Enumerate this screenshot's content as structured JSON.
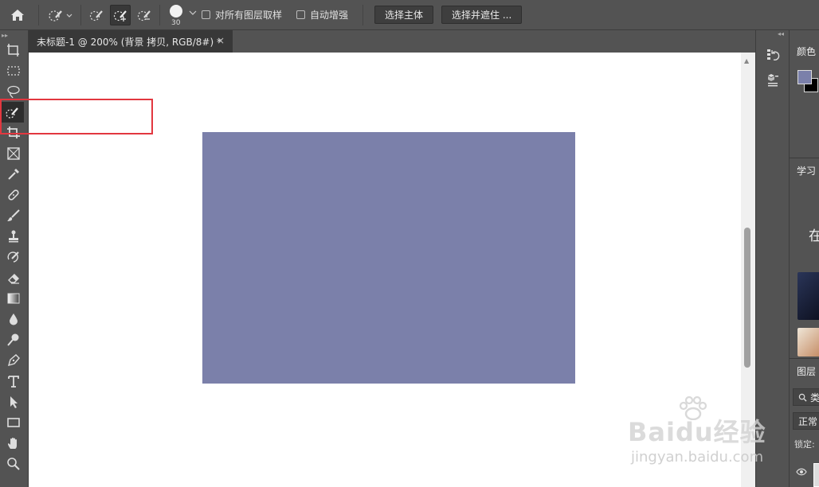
{
  "options_bar": {
    "checkbox_sample_all_layers": "对所有图层取样",
    "checkbox_auto_enhance": "自动增强",
    "btn_select_subject": "选择主体",
    "btn_select_and_mask": "选择并遮住 ...",
    "brush_size": "30"
  },
  "document": {
    "tab_title": "未标题-1 @ 200% (背景 拷贝, RGB/8#) *",
    "tab_close": "×",
    "fill_color": "#7b80aa"
  },
  "panels": {
    "color_title": "颜色",
    "learn_title": "学习",
    "learn_text": "在",
    "layers_title": "图层",
    "layers_search": "类",
    "blend_mode": "正常",
    "lock_label": "锁定:",
    "fg_color": "#7b80aa",
    "bg_color": "#000000"
  },
  "watermark": {
    "logo": "Baidu经验",
    "sub": "jingyan.baidu.com"
  },
  "highlight_color": "#e2373f"
}
